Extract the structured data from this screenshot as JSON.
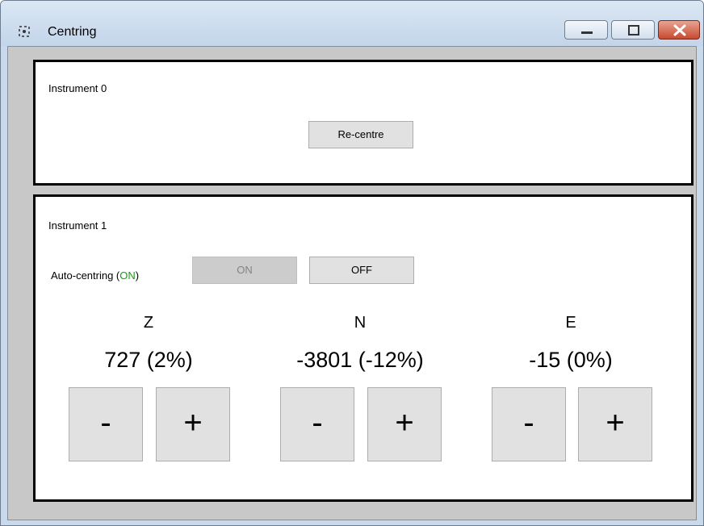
{
  "window": {
    "title": "Centring",
    "controls": [
      "minimize",
      "maximize",
      "close"
    ]
  },
  "instrument0": {
    "title": "Instrument 0",
    "recentre_label": "Re-centre"
  },
  "instrument1": {
    "title": "Instrument 1",
    "autocentring": {
      "label_prefix": "Auto-centring (",
      "status": "ON",
      "label_suffix": ")",
      "on_label": "ON",
      "off_label": "OFF",
      "on_enabled": false,
      "off_enabled": true
    },
    "axes": [
      {
        "name": "Z",
        "value": "727 (2%)",
        "minus": "-",
        "plus": "+"
      },
      {
        "name": "N",
        "value": "-3801 (-12%)",
        "minus": "-",
        "plus": "+"
      },
      {
        "name": "E",
        "value": "-15 (0%)",
        "minus": "-",
        "plus": "+"
      }
    ]
  },
  "colors": {
    "status_on": "#1a9a1a",
    "panel_border": "#000000",
    "background": "#c8c8c8"
  },
  "icons": {
    "app": "crosshair-icon",
    "minimize": "minimize-icon",
    "maximize": "maximize-icon",
    "close": "close-icon"
  }
}
